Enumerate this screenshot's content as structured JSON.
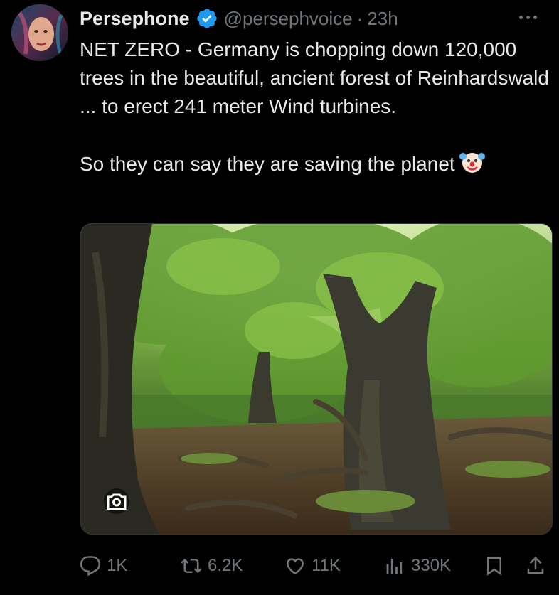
{
  "tweet": {
    "author_name": "Persephone",
    "handle": "@persephvoice",
    "separator": "·",
    "time": "23h",
    "text_paragraph_1": "NET ZERO - Germany is chopping down 120,000 trees in the beautiful, ancient forest of Reinhardswald ... to erect 241 meter Wind turbines.",
    "text_paragraph_2": "So they can say they are saving the planet",
    "emoji": "clown-face"
  },
  "actions": {
    "replies": "1K",
    "retweets": "6.2K",
    "likes": "11K",
    "views": "330K"
  },
  "colors": {
    "background": "#000000",
    "text": "#e7e9ea",
    "muted": "#71767b",
    "verified": "#1d9bf0"
  }
}
